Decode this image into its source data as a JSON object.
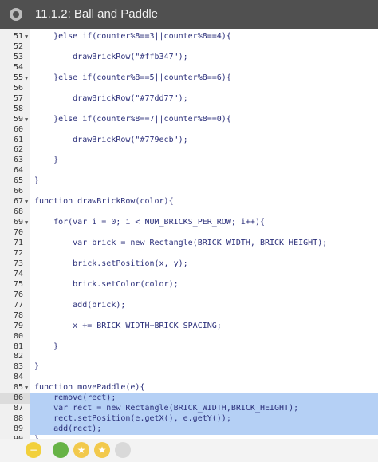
{
  "window": {
    "title": "11.1.2: Ball and Paddle"
  },
  "editor": {
    "lines": [
      {
        "n": "51",
        "fold": true,
        "text": "    }else if(counter%8==3||counter%8==4){"
      },
      {
        "n": "52",
        "fold": false,
        "text": ""
      },
      {
        "n": "53",
        "fold": false,
        "text": "        drawBrickRow(\"#ffb347\");"
      },
      {
        "n": "54",
        "fold": false,
        "text": ""
      },
      {
        "n": "55",
        "fold": true,
        "text": "    }else if(counter%8==5||counter%8==6){"
      },
      {
        "n": "56",
        "fold": false,
        "text": ""
      },
      {
        "n": "57",
        "fold": false,
        "text": "        drawBrickRow(\"#77dd77\");"
      },
      {
        "n": "58",
        "fold": false,
        "text": ""
      },
      {
        "n": "59",
        "fold": true,
        "text": "    }else if(counter%8==7||counter%8==0){"
      },
      {
        "n": "60",
        "fold": false,
        "text": ""
      },
      {
        "n": "61",
        "fold": false,
        "text": "        drawBrickRow(\"#779ecb\");"
      },
      {
        "n": "62",
        "fold": false,
        "text": ""
      },
      {
        "n": "63",
        "fold": false,
        "text": "    }"
      },
      {
        "n": "64",
        "fold": false,
        "text": ""
      },
      {
        "n": "65",
        "fold": false,
        "text": "}"
      },
      {
        "n": "66",
        "fold": false,
        "text": ""
      },
      {
        "n": "67",
        "fold": true,
        "text": "function drawBrickRow(color){"
      },
      {
        "n": "68",
        "fold": false,
        "text": ""
      },
      {
        "n": "69",
        "fold": true,
        "text": "    for(var i = 0; i < NUM_BRICKS_PER_ROW; i++){"
      },
      {
        "n": "70",
        "fold": false,
        "text": ""
      },
      {
        "n": "71",
        "fold": false,
        "text": "        var brick = new Rectangle(BRICK_WIDTH, BRICK_HEIGHT);"
      },
      {
        "n": "72",
        "fold": false,
        "text": ""
      },
      {
        "n": "73",
        "fold": false,
        "text": "        brick.setPosition(x, y);"
      },
      {
        "n": "74",
        "fold": false,
        "text": ""
      },
      {
        "n": "75",
        "fold": false,
        "text": "        brick.setColor(color);"
      },
      {
        "n": "76",
        "fold": false,
        "text": ""
      },
      {
        "n": "77",
        "fold": false,
        "text": "        add(brick);"
      },
      {
        "n": "78",
        "fold": false,
        "text": ""
      },
      {
        "n": "79",
        "fold": false,
        "text": "        x += BRICK_WIDTH+BRICK_SPACING;"
      },
      {
        "n": "80",
        "fold": false,
        "text": ""
      },
      {
        "n": "81",
        "fold": false,
        "text": "    }"
      },
      {
        "n": "82",
        "fold": false,
        "text": ""
      },
      {
        "n": "83",
        "fold": false,
        "text": "}"
      },
      {
        "n": "84",
        "fold": false,
        "text": ""
      },
      {
        "n": "85",
        "fold": true,
        "text": "function movePaddle(e){"
      },
      {
        "n": "86",
        "fold": false,
        "text": "    remove(rect);",
        "selected": true,
        "active": true
      },
      {
        "n": "87",
        "fold": false,
        "text": "    var rect = new Rectangle(BRICK_WIDTH,BRICK_HEIGHT);",
        "selected": true
      },
      {
        "n": "88",
        "fold": false,
        "text": "    rect.setPosition(e.getX(), e.getY());",
        "selected": true
      },
      {
        "n": "89",
        "fold": false,
        "text": "    add(rect);",
        "selected": true
      },
      {
        "n": "90",
        "fold": false,
        "text": "}"
      }
    ]
  },
  "colors": {
    "titlebar": "#505050",
    "selection": "#b5d0f5",
    "keyword": "#2b2f7a"
  },
  "bottom_bar": {
    "buttons": [
      {
        "name": "minus",
        "icon": "minus-icon",
        "glyph": "−",
        "color": "#f2d03b"
      },
      {
        "name": "green",
        "icon": "circle-icon",
        "glyph": "",
        "color": "#67b346"
      },
      {
        "name": "star-1",
        "icon": "star-icon",
        "glyph": "★",
        "color": "#f2c94c"
      },
      {
        "name": "star-2",
        "icon": "star-icon",
        "glyph": "★",
        "color": "#f2c94c"
      },
      {
        "name": "grey",
        "icon": "circle-icon",
        "glyph": "",
        "color": "#d9d9d9"
      }
    ]
  }
}
